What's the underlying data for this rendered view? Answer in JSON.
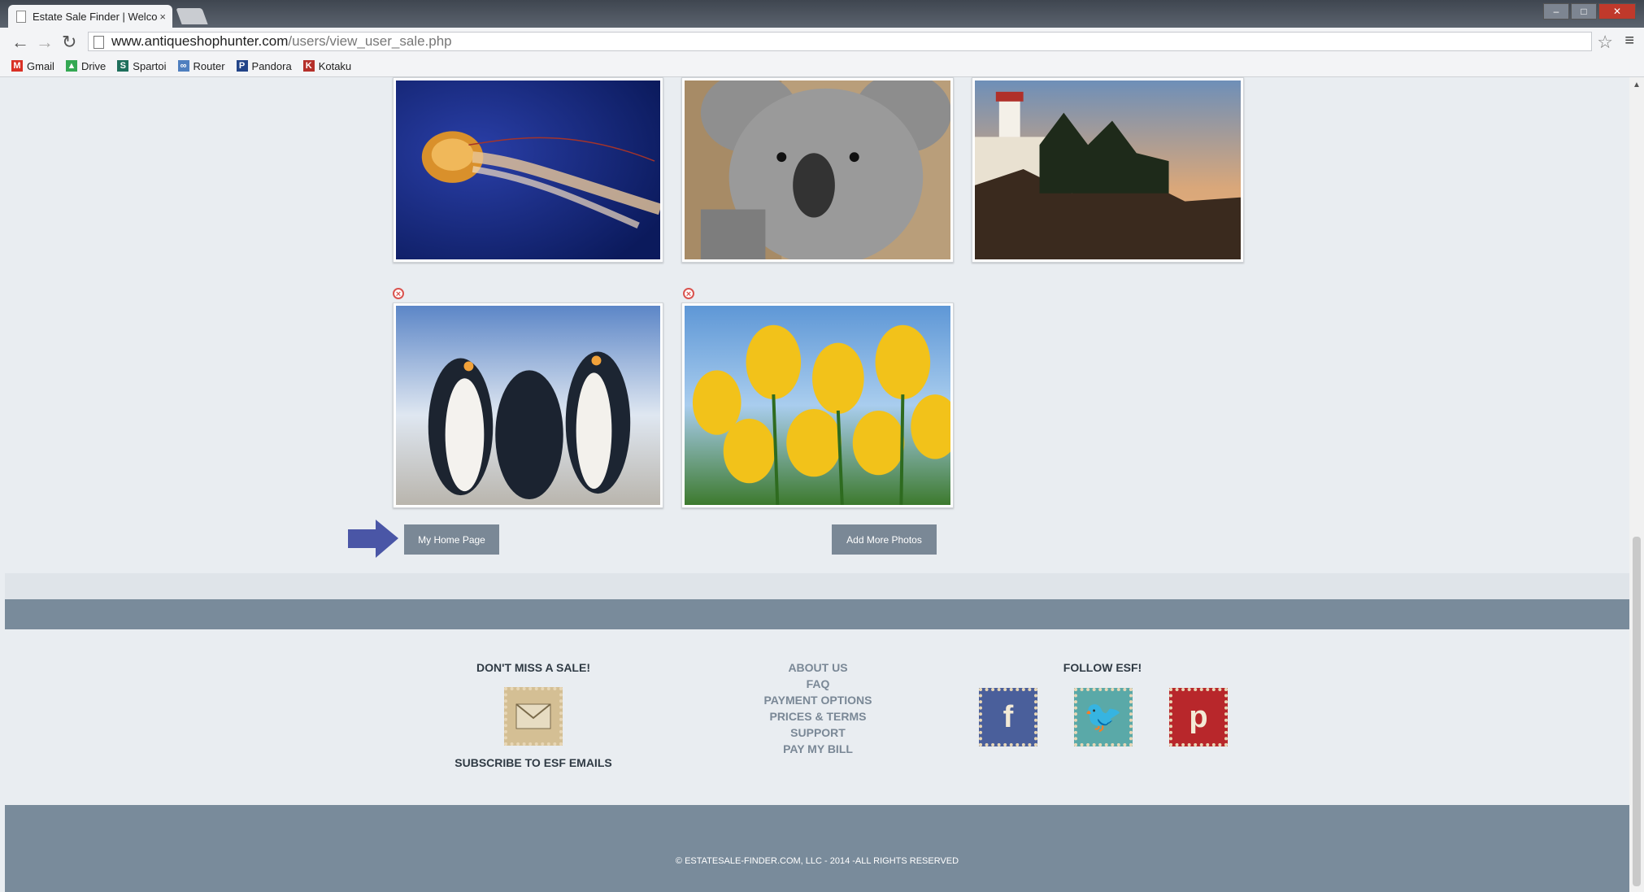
{
  "browser": {
    "tab_title": "Estate Sale Finder | Welco",
    "tab_close": "×",
    "url_host": "www.antiqueshophunter.com",
    "url_path": "/users/view_user_sale.php",
    "bookmarks": [
      {
        "label": "Gmail",
        "icon": "gmail-icon",
        "color": "#d93025",
        "glyph": "M"
      },
      {
        "label": "Drive",
        "icon": "drive-icon",
        "color": "#34a853",
        "glyph": "▲"
      },
      {
        "label": "Spartoi",
        "icon": "spartoi-icon",
        "color": "#1f6f5c",
        "glyph": "S"
      },
      {
        "label": "Router",
        "icon": "router-icon",
        "color": "#4f7fbf",
        "glyph": "∞"
      },
      {
        "label": "Pandora",
        "icon": "pandora-icon",
        "color": "#224488",
        "glyph": "P"
      },
      {
        "label": "Kotaku",
        "icon": "kotaku-icon",
        "color": "#b5302a",
        "glyph": "K"
      }
    ]
  },
  "photos": [
    {
      "name": "jellyfish",
      "deletable": false
    },
    {
      "name": "koala",
      "deletable": false
    },
    {
      "name": "lighthouse",
      "deletable": false
    },
    {
      "name": "penguins",
      "deletable": true
    },
    {
      "name": "tulips",
      "deletable": true
    }
  ],
  "actions": {
    "home_label": "My Home Page",
    "add_photos_label": "Add More Photos",
    "arrow_color": "#4a56a6"
  },
  "footer": {
    "newsletter_title": "DON'T MISS A SALE!",
    "subscribe_label": "SUBSCRIBE TO ESF EMAILS",
    "links": [
      "ABOUT US",
      "FAQ",
      "PAYMENT OPTIONS",
      "PRICES & TERMS",
      "SUPPORT",
      "PAY MY BILL"
    ],
    "follow_title": "FOLLOW ESF!",
    "social": [
      {
        "icon": "facebook-icon",
        "glyph": "f",
        "color": "#4a5f9b"
      },
      {
        "icon": "twitter-icon",
        "glyph": "🐦",
        "color": "#5aa9a8"
      },
      {
        "icon": "pinterest-icon",
        "glyph": "p",
        "color": "#b8272b"
      }
    ],
    "copyright": "© ESTATESALE-FINDER.COM, LLC - 2014 -ALL RIGHTS RESERVED"
  }
}
